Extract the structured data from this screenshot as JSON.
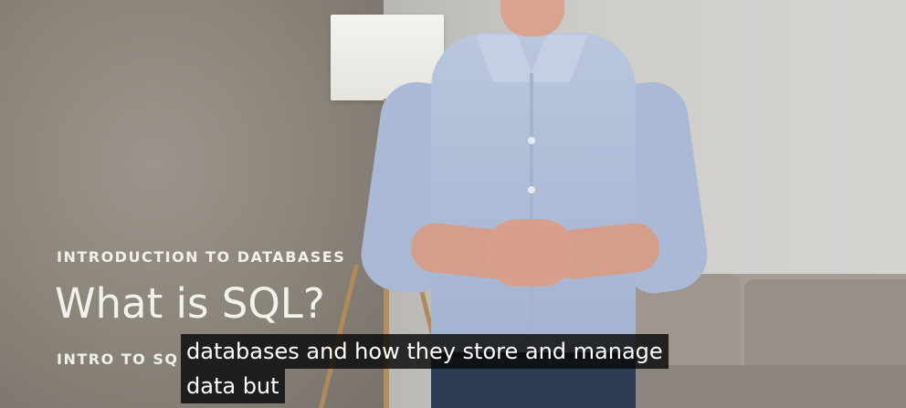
{
  "video": {
    "overlay": {
      "kicker": "INTRODUCTION TO DATABASES",
      "title": "What is SQL?",
      "subtitle": "INTRO TO SQ"
    },
    "captions": {
      "line1": "databases and how they store and manage",
      "line2": "data but"
    },
    "colors": {
      "caption_bg": "#080808",
      "caption_text": "#ffffff",
      "overlay_text": "#f1efec"
    }
  }
}
